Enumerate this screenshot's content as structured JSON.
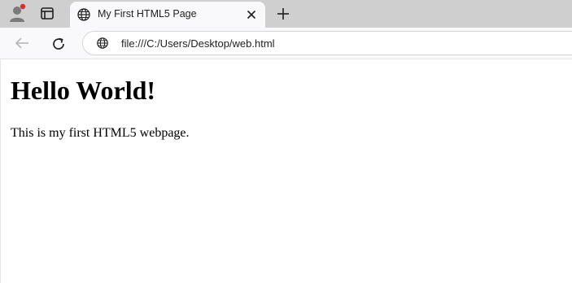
{
  "browser": {
    "tab": {
      "title": "My First HTML5 Page"
    },
    "address_bar": {
      "url": "file:///C:/Users/Desktop/web.html"
    },
    "icons": {
      "profile": "profile-avatar-icon",
      "tab_actions": "tab-actions-icon",
      "site": "globe-icon",
      "close": "close-icon",
      "new_tab": "plus-icon",
      "back": "back-arrow-icon",
      "refresh": "refresh-icon"
    },
    "colors": {
      "titlebar": "#cfcfcf",
      "toolbar": "#f9f9fb",
      "profile_badge": "#d93025"
    }
  },
  "page": {
    "heading": "Hello World!",
    "paragraph": "This is my first HTML5 webpage."
  }
}
